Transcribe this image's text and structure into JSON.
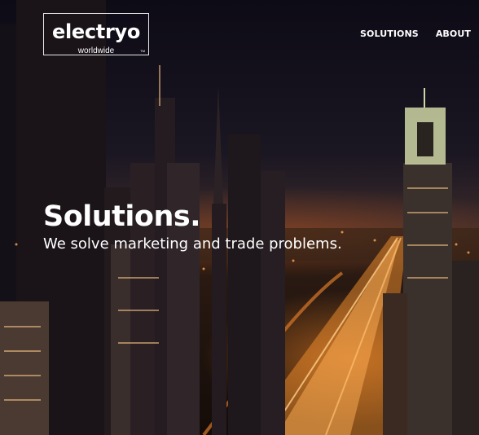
{
  "logo": {
    "wordmark": "electryo",
    "tagline": "worldwide",
    "trademark": "TM"
  },
  "nav": {
    "items": [
      {
        "label": "SOLUTIONS"
      },
      {
        "label": "ABOUT"
      }
    ]
  },
  "hero": {
    "title": "Solutions.",
    "subtitle": "We solve marketing and trade problems."
  }
}
